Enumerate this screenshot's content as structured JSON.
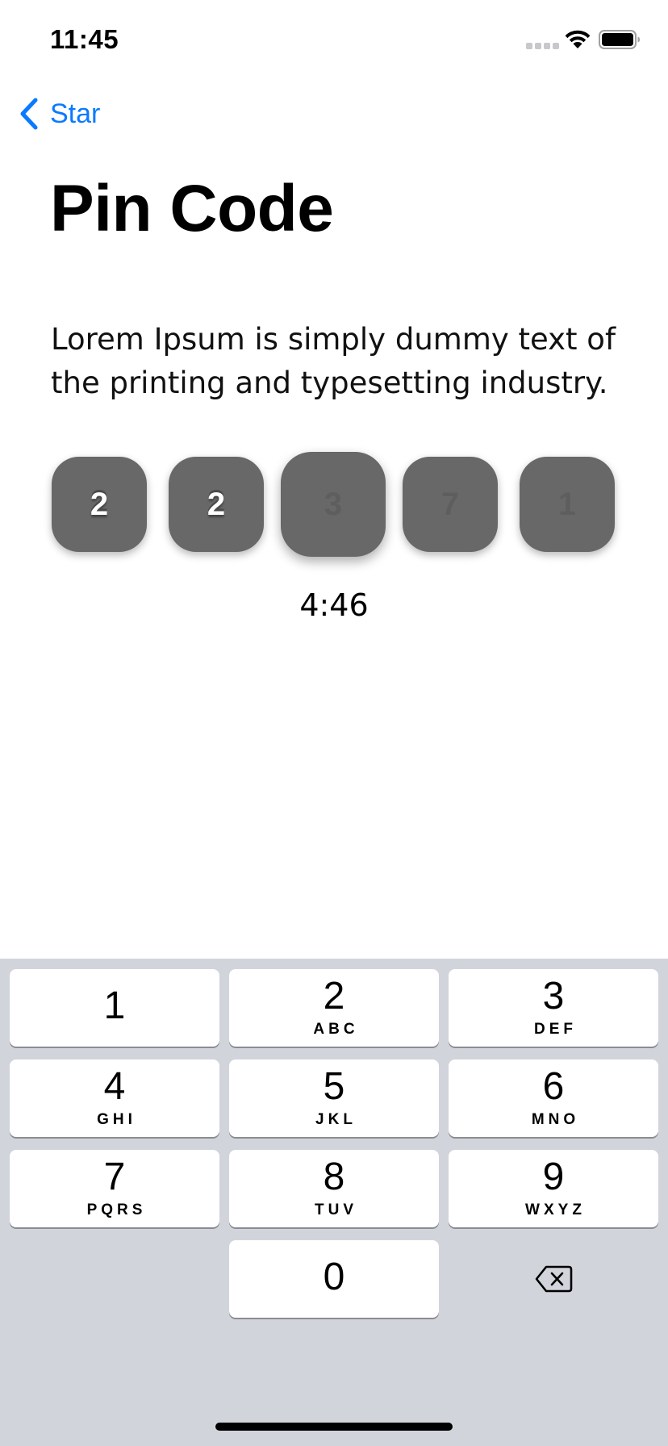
{
  "status_bar": {
    "time": "11:45"
  },
  "nav": {
    "back_label": "Star"
  },
  "page": {
    "title": "Pin Code",
    "description": "Lorem Ipsum is simply dummy text of the printing and typesetting industry.",
    "pin_digits": [
      {
        "value": "2",
        "state": "filled"
      },
      {
        "value": "2",
        "state": "filled"
      },
      {
        "value": "3",
        "state": "active"
      },
      {
        "value": "7",
        "state": "empty"
      },
      {
        "value": "1",
        "state": "empty"
      }
    ],
    "timer": "4:46"
  },
  "keyboard": {
    "keys": [
      {
        "digit": "1",
        "letters": ""
      },
      {
        "digit": "2",
        "letters": "ABC"
      },
      {
        "digit": "3",
        "letters": "DEF"
      },
      {
        "digit": "4",
        "letters": "GHI"
      },
      {
        "digit": "5",
        "letters": "JKL"
      },
      {
        "digit": "6",
        "letters": "MNO"
      },
      {
        "digit": "7",
        "letters": "PQRS"
      },
      {
        "digit": "8",
        "letters": "TUV"
      },
      {
        "digit": "9",
        "letters": "WXYZ"
      },
      {
        "digit": "0",
        "letters": ""
      }
    ],
    "delete_icon": "delete-backspace-icon"
  },
  "colors": {
    "accent": "#0a7aff",
    "pin_box": "#686868",
    "keyboard_bg": "#d1d4db"
  }
}
